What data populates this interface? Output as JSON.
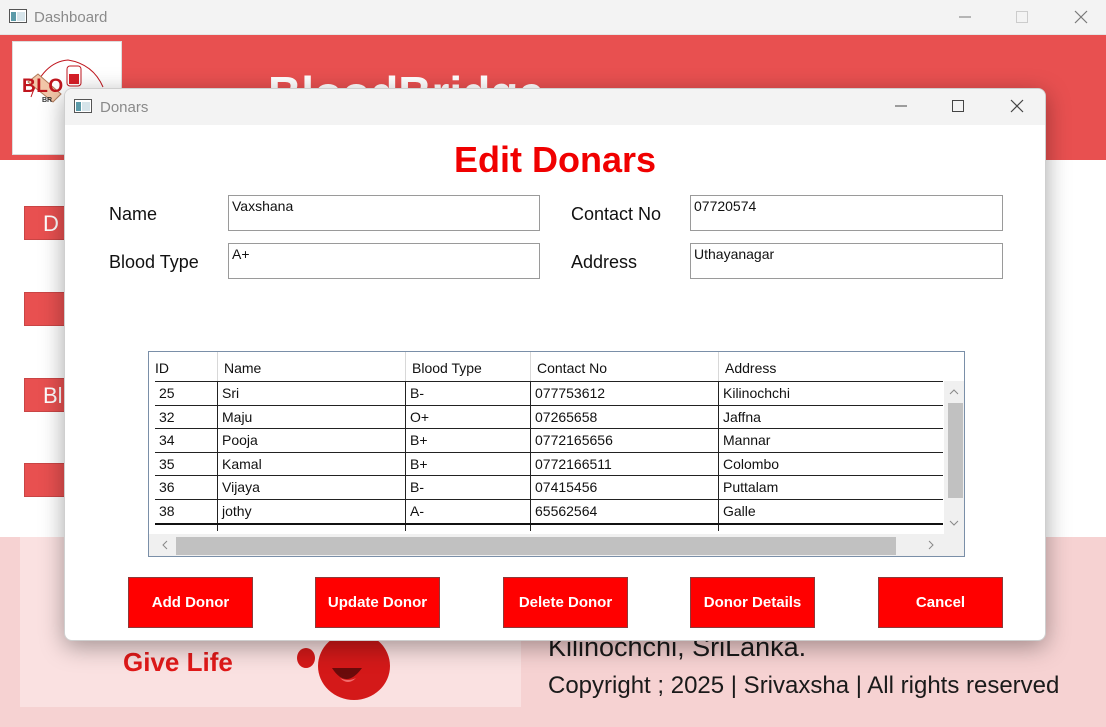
{
  "dashboard": {
    "window_title": "Dashboard",
    "logo_text": "BLO",
    "logo_subtext": "BR",
    "header_heading": "BloodBridge",
    "side_buttons": [
      "D",
      "",
      "Bl",
      ""
    ],
    "give_life": "Give Life",
    "footer_location": "Kilinochchi, SriLanka.",
    "footer_copyright": "Copyright ; 2025 | Srivaxsha | All rights reserved"
  },
  "modal": {
    "window_title": "Donars",
    "heading": "Edit Donars",
    "form": {
      "name_label": "Name",
      "name_value": "Vaxshana",
      "contact_label": "Contact No",
      "contact_value": "07720574",
      "blood_label": "Blood Type",
      "blood_value": "A+",
      "address_label": "Address",
      "address_value": "Uthayanagar"
    },
    "grid": {
      "columns": [
        "ID",
        "Name",
        "Blood Type",
        "Contact No",
        "Address"
      ],
      "rows": [
        [
          "25",
          "Sri",
          "B-",
          "077753612",
          "Kilinochchi"
        ],
        [
          "32",
          "Maju",
          "O+",
          "07265658",
          "Jaffna"
        ],
        [
          "34",
          "Pooja",
          "B+",
          "0772165656",
          "Mannar"
        ],
        [
          "35",
          "Kamal",
          "B+",
          "0772166511",
          "Colombo"
        ],
        [
          "36",
          "Vijaya",
          "B-",
          "07415456",
          "Puttalam"
        ],
        [
          "38",
          "jothy",
          "A-",
          "65562564",
          "Galle"
        ]
      ]
    },
    "buttons": {
      "add": "Add Donor",
      "update": "Update Donor",
      "delete": "Delete Donor",
      "details": "Donor Details",
      "cancel": "Cancel"
    }
  },
  "colors": {
    "brand_red": "#e85050",
    "button_red": "#ff0000",
    "heading_red": "#f00000"
  }
}
